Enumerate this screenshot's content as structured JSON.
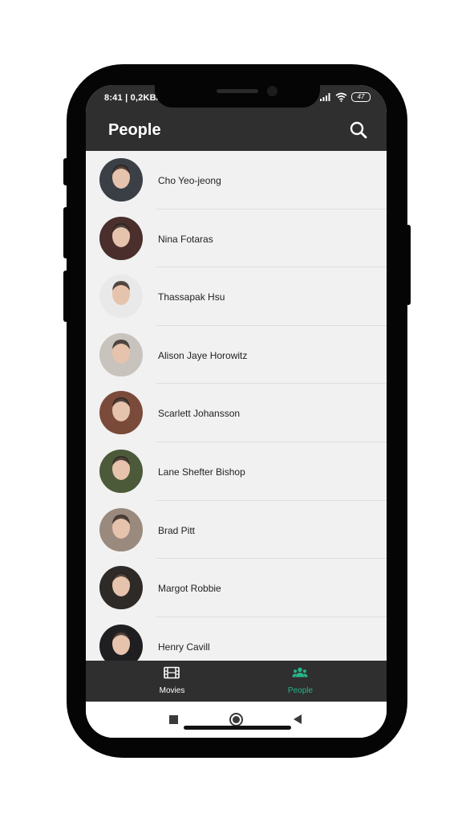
{
  "status_bar": {
    "time": "8:41 | 0,2KB/",
    "battery": "47"
  },
  "app_bar": {
    "title": "People",
    "search_icon": "search-icon"
  },
  "people": [
    {
      "name": "Cho Yeo-jeong",
      "avatar_color": "#3b3f46"
    },
    {
      "name": "Nina Fotaras",
      "avatar_color": "#4a2f2c"
    },
    {
      "name": "Thassapak Hsu",
      "avatar_color": "#e9e9e9"
    },
    {
      "name": "Alison Jaye Horowitz",
      "avatar_color": "#c9c3bd"
    },
    {
      "name": "Scarlett Johansson",
      "avatar_color": "#7a4a3a"
    },
    {
      "name": "Lane Shefter Bishop",
      "avatar_color": "#4c5a3a"
    },
    {
      "name": "Brad Pitt",
      "avatar_color": "#9a8a7d"
    },
    {
      "name": "Margot Robbie",
      "avatar_color": "#2e2a28"
    },
    {
      "name": "Henry Cavill",
      "avatar_color": "#1f1f22"
    }
  ],
  "bottom_nav": {
    "items": [
      {
        "label": "Movies",
        "icon": "film-icon",
        "active": false
      },
      {
        "label": "People",
        "icon": "people-icon",
        "active": true
      }
    ],
    "active_color": "#26b48a",
    "inactive_color": "#ffffff"
  },
  "system_nav": {
    "icons": [
      "recents-icon",
      "home-icon",
      "back-icon"
    ]
  }
}
